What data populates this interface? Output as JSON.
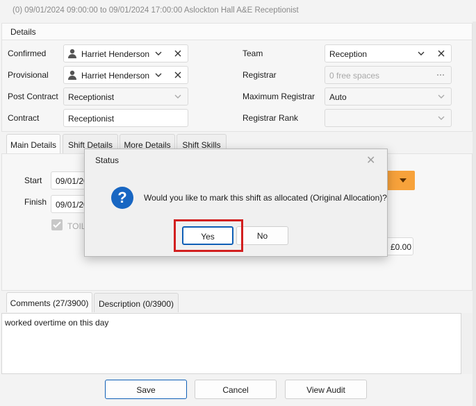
{
  "window": {
    "title": "(0) 09/01/2024 09:00:00 to 09/01/2024 17:00:00 Aslockton Hall A&E Receptionist"
  },
  "details": {
    "header": "Details",
    "confirmed_label": "Confirmed",
    "confirmed_value": "Harriet Henderson",
    "provisional_label": "Provisional",
    "provisional_value": "Harriet Henderson",
    "post_contract_label": "Post Contract",
    "post_contract_value": "Receptionist",
    "contract_label": "Contract",
    "contract_value": "Receptionist",
    "team_label": "Team",
    "team_value": "Reception",
    "registrar_label": "Registrar",
    "registrar_placeholder": "0 free spaces",
    "max_registrar_label": "Maximum Registrar",
    "max_registrar_value": "Auto",
    "registrar_rank_label": "Registrar Rank",
    "registrar_rank_value": ""
  },
  "tabs": [
    {
      "label": "Main Details"
    },
    {
      "label": "Shift Details"
    },
    {
      "label": "More Details"
    },
    {
      "label": "Shift Skills"
    }
  ],
  "main": {
    "start_label": "Start",
    "start_date": "09/01/20",
    "finish_label": "Finish",
    "finish_date": "09/01/20",
    "toil_label": "TOIL",
    "amount": "£0.00"
  },
  "comment_tabs": [
    {
      "label": "Comments (27/3900)"
    },
    {
      "label": "Description (0/3900)"
    }
  ],
  "comments": {
    "text": "worked overtime on this day"
  },
  "footer": {
    "save_label": "Save",
    "cancel_label": "Cancel",
    "view_audit_label": "View Audit"
  },
  "dialog": {
    "title": "Status",
    "close_glyph": "✕",
    "icon_glyph": "?",
    "message": "Would you like to mark this shift as allocated (Original Allocation)?",
    "yes_label": "Yes",
    "no_label": "No"
  },
  "colors": {
    "accent": "#0f5fb6",
    "info_icon": "#1866c2",
    "highlight": "#d21f1f",
    "orange_button": "#f7a23b"
  }
}
